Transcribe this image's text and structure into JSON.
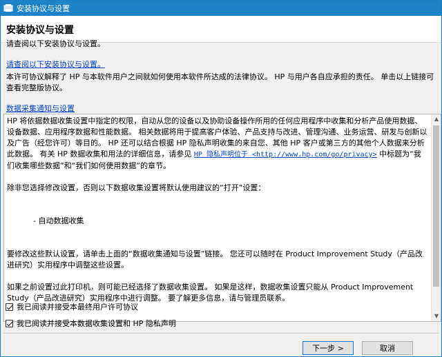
{
  "window": {
    "title": "安装协议与设置",
    "accent": "#1e83c6"
  },
  "header": {
    "title": "安装协议与设置",
    "subtitle": "请查阅以下安装协议与设置。"
  },
  "license": {
    "link_text": "请查阅以下安装协议与设置。",
    "description": "本许可协议解释了 HP 与本软件用户之间就如何使用本软件所达成的法律协议。 HP 与用户各自应承担的责任。 单击以上链接可查看完整版协议。"
  },
  "data_collection": {
    "link_text": "数据采集通知与设置",
    "para1": "HP 将依据数据收集设置中指定的权限，自动从您的设备以及协助设备操作所用的任何应用程序中收集和分析产品使用数据、设备数据、应用程序数据和性能数据。 相关数据将用于提高客户体验、产品支持与改进、管理沟通、业务运营、研发与创新以及广告（经您许可）等目的。 HP 还可以结合根据 HP 隐私声明收集的来自您、其他 HP 客户或第三方的其他个人数据来分析此数据。 有关 HP 数据收集和用法的详细信息，请参见",
    "privacy_link": "HP 隐私声明位于 <http://www.hp.com/go/privacy>",
    "para1_end": "中标题为“我们收集哪些数据”和“我们如何使用数据”的章节。",
    "para2": "除非您选择修改设置，否则以下数据收集设置将默认使用建议的“打开”设置：",
    "bullet": "- 自动数据收集",
    "para3": "要修改这些默认设置，请单击上面的“数据收集通知与设置”链接。 您还可以随时在 Product Improvement Study（产品改进研究）实用程序中调整这些设置。",
    "para4": "如果之前设置过此打印机，则可能已经选择了数据收集设置。 如果是这样，数据收集设置只能从 Product Improvement Study（产品改进研究）实用程序中进行调整。 要了解更多信息，请与管理员联系。"
  },
  "checkboxes": {
    "eula": "我已阅读并接受本最终用户许可协议",
    "privacy": "我已阅读并接受本数据收集设置和 HP 隐私声明"
  },
  "buttons": {
    "next": "下一步 >",
    "cancel": "取消"
  }
}
